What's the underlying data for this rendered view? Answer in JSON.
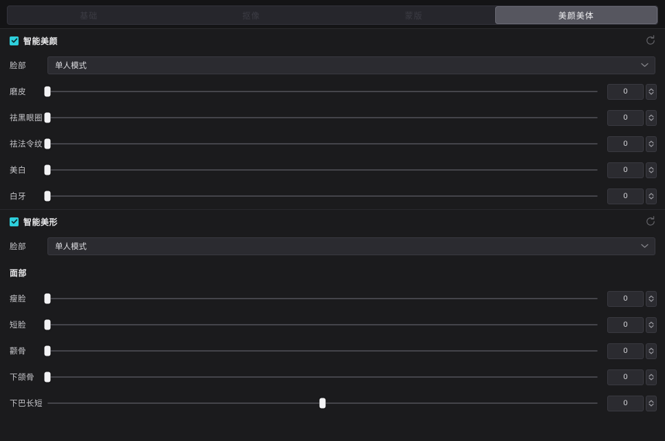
{
  "tabs": [
    {
      "label": "基础",
      "active": false
    },
    {
      "label": "抠像",
      "active": false
    },
    {
      "label": "蒙版",
      "active": false
    },
    {
      "label": "美颜美体",
      "active": true
    }
  ],
  "colors": {
    "accent": "#2ecfdc",
    "panel_bg": "#1b1b1d",
    "tab_active_bg": "#56565f",
    "field_bg": "#2b2b30"
  },
  "icons": {
    "reset": "reset-icon",
    "chevron_down": "chevron-down-icon",
    "check": "check-icon",
    "spinner_up": "chevron-up-icon",
    "spinner_down": "chevron-down-icon"
  },
  "sections": [
    {
      "title": "智能美颜",
      "enabled": true,
      "reset_label": "重置",
      "select": {
        "label": "脸部",
        "value": "单人模式"
      },
      "sliders": [
        {
          "label": "磨皮",
          "value": "0",
          "percent": 0
        },
        {
          "label": "祛黑眼圈",
          "value": "0",
          "percent": 0
        },
        {
          "label": "祛法令纹",
          "value": "0",
          "percent": 0
        },
        {
          "label": "美白",
          "value": "0",
          "percent": 0
        },
        {
          "label": "白牙",
          "value": "0",
          "percent": 0
        }
      ]
    },
    {
      "title": "智能美形",
      "enabled": true,
      "reset_label": "重置",
      "select": {
        "label": "脸部",
        "value": "单人模式"
      },
      "group_label": "面部",
      "sliders": [
        {
          "label": "瘦脸",
          "value": "0",
          "percent": 0
        },
        {
          "label": "短脸",
          "value": "0",
          "percent": 0
        },
        {
          "label": "颧骨",
          "value": "0",
          "percent": 0
        },
        {
          "label": "下颌骨",
          "value": "0",
          "percent": 0
        },
        {
          "label": "下巴长短",
          "value": "0",
          "percent": 50
        }
      ]
    }
  ]
}
